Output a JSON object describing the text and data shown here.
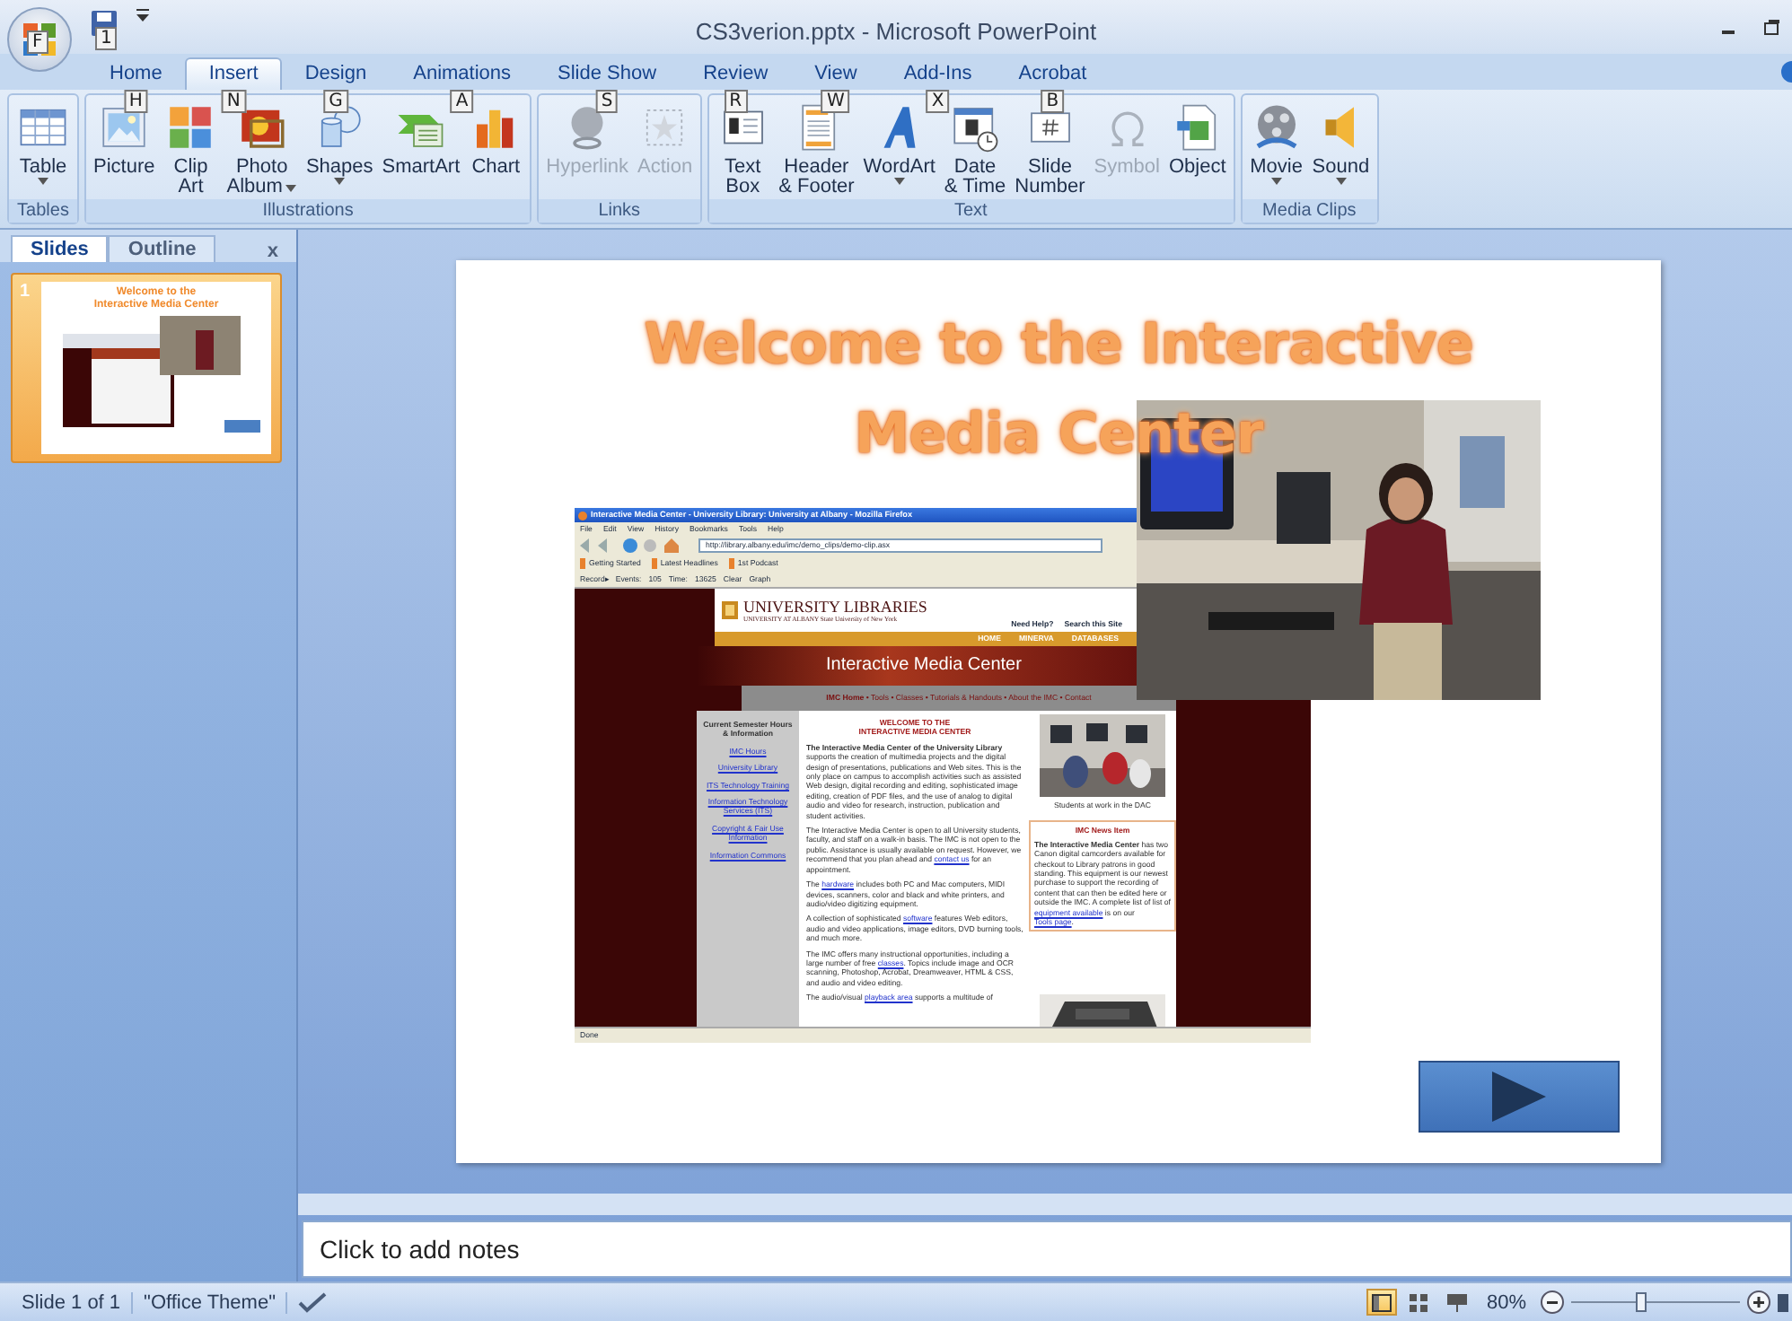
{
  "window": {
    "title": "CS3verion.pptx - Microsoft PowerPoint",
    "office_button_key": "F",
    "quick_access_key": "1"
  },
  "ribbon_tabs": [
    {
      "label": "Home",
      "key": "H",
      "selected": false
    },
    {
      "label": "Insert",
      "key": "N",
      "selected": true
    },
    {
      "label": "Design",
      "key": "G",
      "selected": false
    },
    {
      "label": "Animations",
      "key": "A",
      "selected": false
    },
    {
      "label": "Slide Show",
      "key": "S",
      "selected": false
    },
    {
      "label": "Review",
      "key": "R",
      "selected": false
    },
    {
      "label": "View",
      "key": "W",
      "selected": false
    },
    {
      "label": "Add-Ins",
      "key": "X",
      "selected": false
    },
    {
      "label": "Acrobat",
      "key": "B",
      "selected": false
    }
  ],
  "ribbon_groups": [
    {
      "label": "Tables",
      "commands": [
        {
          "kind": "table",
          "lines": [
            "Table"
          ],
          "dropdown": true,
          "disabled": false
        }
      ]
    },
    {
      "label": "Illustrations",
      "commands": [
        {
          "kind": "picture",
          "lines": [
            "Picture"
          ],
          "dropdown": false,
          "disabled": false
        },
        {
          "kind": "clipart",
          "lines": [
            "Clip",
            "Art"
          ],
          "dropdown": false,
          "disabled": false
        },
        {
          "kind": "photoalbum",
          "lines": [
            "Photo",
            "Album"
          ],
          "dropdown": true,
          "disabled": false
        },
        {
          "kind": "shapes",
          "lines": [
            "Shapes"
          ],
          "dropdown": true,
          "disabled": false
        },
        {
          "kind": "smartart",
          "lines": [
            "SmartArt"
          ],
          "dropdown": false,
          "disabled": false
        },
        {
          "kind": "chart",
          "lines": [
            "Chart"
          ],
          "dropdown": false,
          "disabled": false
        }
      ]
    },
    {
      "label": "Links",
      "commands": [
        {
          "kind": "hyperlink",
          "lines": [
            "Hyperlink"
          ],
          "dropdown": false,
          "disabled": true
        },
        {
          "kind": "action",
          "lines": [
            "Action"
          ],
          "dropdown": false,
          "disabled": true
        }
      ]
    },
    {
      "label": "Text",
      "commands": [
        {
          "kind": "textbox",
          "lines": [
            "Text",
            "Box"
          ],
          "dropdown": false,
          "disabled": false
        },
        {
          "kind": "headerfooter",
          "lines": [
            "Header",
            "& Footer"
          ],
          "dropdown": false,
          "disabled": false
        },
        {
          "kind": "wordart",
          "lines": [
            "WordArt"
          ],
          "dropdown": true,
          "disabled": false
        },
        {
          "kind": "datetime",
          "lines": [
            "Date",
            "& Time"
          ],
          "dropdown": false,
          "disabled": false
        },
        {
          "kind": "slidenumber",
          "lines": [
            "Slide",
            "Number"
          ],
          "dropdown": false,
          "disabled": false
        },
        {
          "kind": "symbol",
          "lines": [
            "Symbol"
          ],
          "dropdown": false,
          "disabled": true
        },
        {
          "kind": "object",
          "lines": [
            "Object"
          ],
          "dropdown": false,
          "disabled": false
        }
      ]
    },
    {
      "label": "Media Clips",
      "commands": [
        {
          "kind": "movie",
          "lines": [
            "Movie"
          ],
          "dropdown": true,
          "disabled": false
        },
        {
          "kind": "sound",
          "lines": [
            "Sound"
          ],
          "dropdown": true,
          "disabled": false
        }
      ]
    }
  ],
  "slides_pane": {
    "tabs": [
      {
        "label": "Slides",
        "selected": true
      },
      {
        "label": "Outline",
        "selected": false
      }
    ],
    "close": "x",
    "thumbnails": [
      {
        "number": "1",
        "selected": true,
        "title": "Welcome to the Interactive Media Center"
      }
    ]
  },
  "slide": {
    "title_lines": [
      "Welcome to the Interactive",
      "Media Center"
    ],
    "browser": {
      "title": "Interactive Media Center - University Library: University at Albany - Mozilla Firefox",
      "menu": [
        "File",
        "Edit",
        "View",
        "History",
        "Bookmarks",
        "Tools",
        "Help"
      ],
      "address": "http://library.albany.edu/imc/demo_clips/demo-clip.asx",
      "bookmarks": [
        "Getting Started",
        "Latest Headlines",
        "1st Podcast"
      ],
      "record_bar": [
        "Record▸",
        "Events:",
        "105",
        "Time:",
        "13625",
        "Clear",
        "Graph"
      ],
      "page": {
        "header_title": "UNIVERSITY LIBRARIES",
        "header_subtitle": "UNIVERSITY AT ALBANY State University of New York",
        "header_links": [
          "Need Help?",
          "Search this Site"
        ],
        "top_nav": [
          "HOME",
          "MINERVA",
          "DATABASES"
        ],
        "banner": "Interactive Media Center",
        "nav": "**IMC Home** • Tools • Classes • Tutorials & Handouts • About the IMC • Contact",
        "sidebar_heading": "Current Semester Hours & Information",
        "sidebar_links": [
          "IMC Hours",
          "University Library",
          "ITS Technology Training",
          "Information Technology Services (ITS)",
          "Copyright & Fair Use Information",
          "Information Commons"
        ],
        "welcome_lines": [
          "WELCOME TO THE",
          "INTERACTIVE MEDIA CENTER"
        ],
        "paragraphs": [
          [
            {
              "kind": "bold",
              "text": "The Interactive Media Center of the University Library"
            },
            {
              "kind": "plain",
              "text": " supports the creation of multimedia projects and the digital design of presentations, publications and Web sites. This is the only place on campus to accomplish activities such as assisted Web design, digital recording and editing, sophisticated image editing, creation of PDF files, and the use of analog to digital audio and video for research, instruction, publication and student activities."
            }
          ],
          [
            {
              "kind": "plain",
              "text": "The Interactive Media Center is open to all University students, faculty, and staff on a walk-in basis. The IMC is not open to the public. Assistance is usually available on request. However, we recommend that you plan ahead and "
            },
            {
              "kind": "link",
              "text": "contact us"
            },
            {
              "kind": "plain",
              "text": " for an appointment."
            }
          ],
          [
            {
              "kind": "plain",
              "text": "The "
            },
            {
              "kind": "link",
              "text": "hardware"
            },
            {
              "kind": "plain",
              "text": " includes both PC and Mac computers, MIDI devices, scanners, color and black and white printers, and audio/video digitizing equipment."
            }
          ],
          [
            {
              "kind": "plain",
              "text": "A collection of sophisticated "
            },
            {
              "kind": "link",
              "text": "software"
            },
            {
              "kind": "plain",
              "text": " features Web editors, audio and video applications, image editors, DVD burning tools, and much more."
            }
          ],
          [
            {
              "kind": "plain",
              "text": "The IMC offers many instructional opportunities, including a large number of free "
            },
            {
              "kind": "link",
              "text": "classes"
            },
            {
              "kind": "plain",
              "text": ". Topics include image and OCR scanning, Photoshop, Acrobat, Dreamweaver, HTML & CSS, and audio and video editing."
            }
          ],
          [
            {
              "kind": "plain",
              "text": "The audio/visual "
            },
            {
              "kind": "link",
              "text": "playback area"
            },
            {
              "kind": "plain",
              "text": " supports a multitude of"
            }
          ]
        ],
        "photo_caption": "Students at work in the DAC",
        "news_title": "IMC News Item",
        "news": [
          {
            "kind": "bold",
            "text": "The Interactive Media Center"
          },
          {
            "kind": "plain",
            "text": " has two Canon digital camcorders available for checkout to Library patrons in good standing. This equipment is our newest purchase to support the recording of content that can then be edited here or outside the IMC. A complete list of list of "
          },
          {
            "kind": "link",
            "text": "equipment available"
          },
          {
            "kind": "plain",
            "text": " is on our "
          },
          {
            "kind": "link",
            "text": "Tools page"
          },
          {
            "kind": "plain",
            "text": "."
          }
        ]
      },
      "status": "Done"
    }
  },
  "notes": {
    "placeholder": "Click to add notes"
  },
  "status_bar": {
    "slide_info": "Slide 1 of 1",
    "theme": "\"Office Theme\"",
    "views": [
      {
        "kind": "normal",
        "selected": true
      },
      {
        "kind": "sorter",
        "selected": false
      },
      {
        "kind": "slideshow",
        "selected": false
      }
    ],
    "zoom": "80%",
    "zoom_slider": {
      "level": 0.42
    }
  }
}
